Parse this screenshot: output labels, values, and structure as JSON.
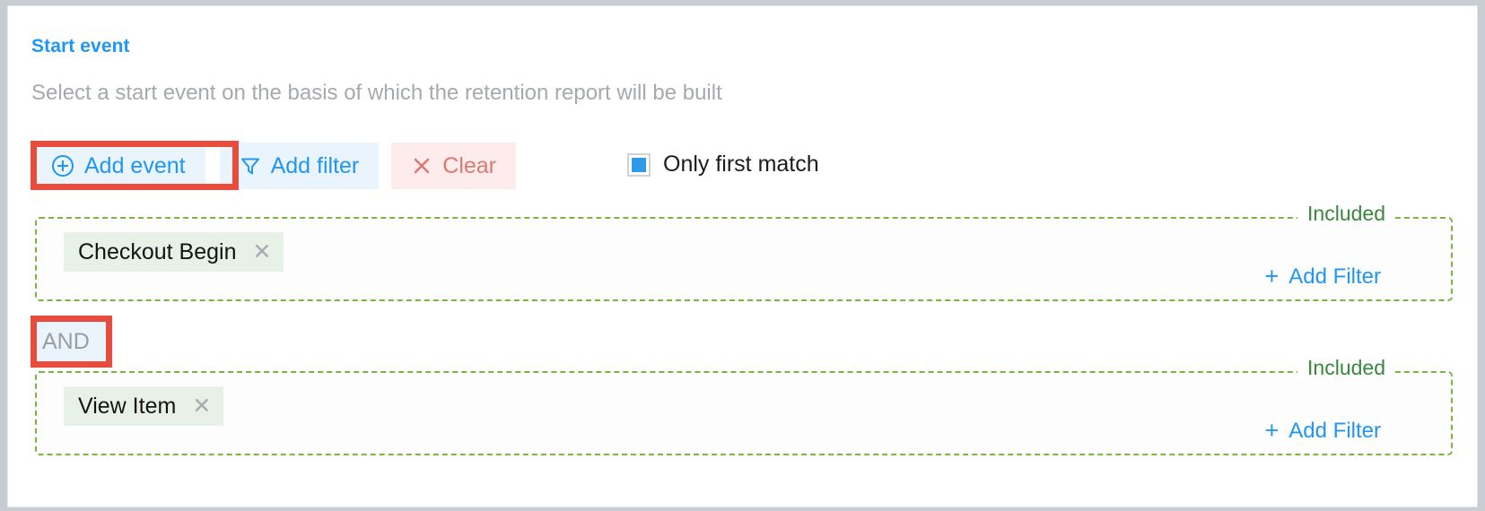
{
  "section": {
    "title": "Start event",
    "description": "Select a start event on the basis of which the retention report will be built",
    "title_color": "#2196f3",
    "description_color": "#a6a9ad"
  },
  "toolbar": {
    "add_event_label": "Add event",
    "add_event_icon": "plus-circle-icon",
    "add_filter_label": "Add filter",
    "add_filter_icon": "funnel-icon",
    "clear_label": "Clear",
    "clear_icon": "close-x-icon",
    "button_bg": "#eaf4fd",
    "button_text_color": "#2196f3",
    "clear_bg": "#fdeceb",
    "clear_text_color": "#da7b72"
  },
  "only_first_match": {
    "label": "Only first match",
    "checked": true,
    "check_color": "#2f9ae8"
  },
  "event_groups": [
    {
      "legend": "Included",
      "legend_color": "#38873a",
      "border_color": "#7cb342",
      "chip": {
        "label": "Checkout Begin",
        "remove_icon": "close-x-icon",
        "bg": "#e8f1e7"
      },
      "add_filter": {
        "label": "Add Filter",
        "icon": "plus-icon",
        "color": "#2196f3"
      }
    },
    {
      "legend": "Included",
      "legend_color": "#38873a",
      "border_color": "#7cb342",
      "chip": {
        "label": "View Item",
        "remove_icon": "close-x-icon",
        "bg": "#e8f1e7"
      },
      "add_filter": {
        "label": "Add Filter",
        "icon": "plus-icon",
        "color": "#2196f3"
      }
    }
  ],
  "operator": {
    "label": "AND",
    "bg": "#eaf4fd",
    "text_color": "#9a9da2"
  },
  "annotations": {
    "highlight_color": "#e84c3d",
    "targets": [
      "add-event-button",
      "and-operator-toggle"
    ]
  }
}
